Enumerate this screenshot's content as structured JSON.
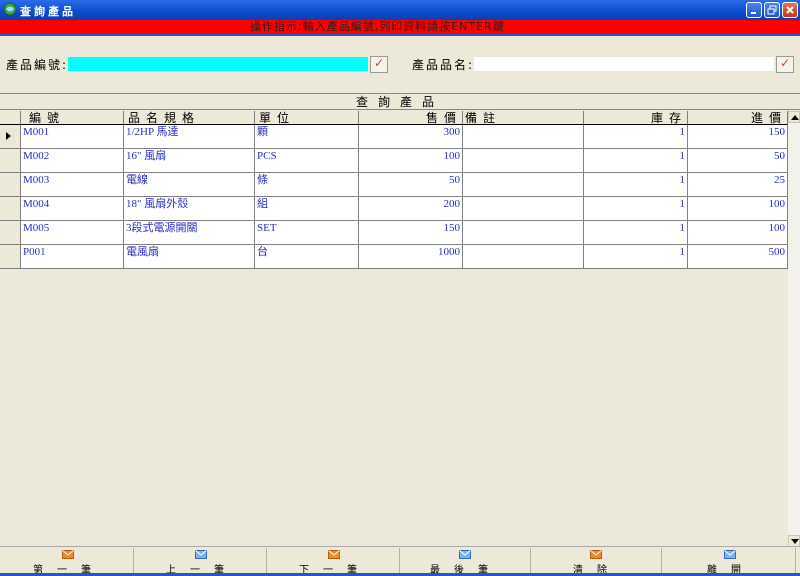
{
  "window": {
    "title": "查詢產品"
  },
  "instruction": "操作指示:輸入產品編號,列印資料請按ENTER鍵",
  "search": {
    "code_label": "產品編號:",
    "code_value": "",
    "name_label": "產品品名:",
    "name_value": ""
  },
  "grid": {
    "caption": "查詢產品",
    "columns": [
      "編號",
      "品名規格",
      "單位",
      "售價",
      "備註",
      "庫存",
      "進價"
    ],
    "rows": [
      [
        "M001",
        "1/2HP 馬達",
        "顆",
        "300",
        "",
        "1",
        "150"
      ],
      [
        "M002",
        "16\" 風扇",
        "PCS",
        "100",
        "",
        "1",
        "50"
      ],
      [
        "M003",
        "電線",
        "條",
        "50",
        "",
        "1",
        "25"
      ],
      [
        "M004",
        "18\" 風扇外殼",
        "組",
        "200",
        "",
        "1",
        "100"
      ],
      [
        "M005",
        "3段式電源開關",
        "SET",
        "150",
        "",
        "1",
        "100"
      ],
      [
        "P001",
        "電風扇",
        "台",
        "1000",
        "",
        "1",
        "500"
      ]
    ]
  },
  "toolbar": {
    "buttons": [
      {
        "label": "第一筆",
        "icon": "envelope-orange-icon"
      },
      {
        "label": "上一筆",
        "icon": "envelope-blue-icon"
      },
      {
        "label": "下一筆",
        "icon": "envelope-orange-icon"
      },
      {
        "label": "最後筆",
        "icon": "envelope-blue-icon"
      },
      {
        "label": "清除",
        "icon": "envelope-orange-icon"
      },
      {
        "label": "離開",
        "icon": "envelope-blue-icon"
      }
    ]
  },
  "colors": {
    "instruction_bg": "#FF0000",
    "code_field_bg": "#00FFFF",
    "grid_text": "#2B2BC8"
  }
}
